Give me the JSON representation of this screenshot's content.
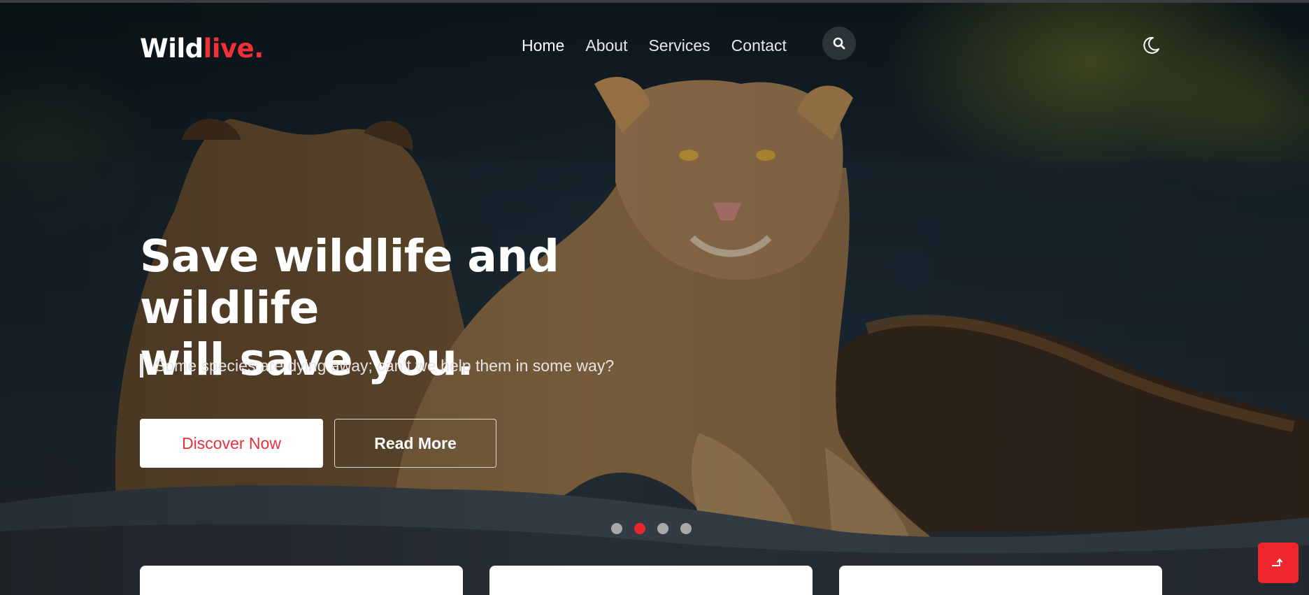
{
  "header": {
    "logo": {
      "text_main": "Wild",
      "text_accent": "live."
    },
    "nav": [
      {
        "label": "Home",
        "active": true
      },
      {
        "label": "About",
        "active": false
      },
      {
        "label": "Services",
        "active": false
      },
      {
        "label": "Contact",
        "active": false
      }
    ],
    "search_icon": "search-icon",
    "theme_icon": "moon-icon"
  },
  "hero": {
    "title_line1": "Save wildlife and wildlife",
    "title_line2": "will save you.",
    "subtitle": "Some species are dying away; can’t we help them in some way?",
    "primary_button": "Discover Now",
    "secondary_button": "Read More",
    "slider": {
      "count": 4,
      "active_index": 1
    }
  },
  "colors": {
    "accent": "#f0313a",
    "white": "#ffffff",
    "dot_inactive": "#a9a9a9"
  },
  "scroll_top_icon": "arrow-up-icon"
}
